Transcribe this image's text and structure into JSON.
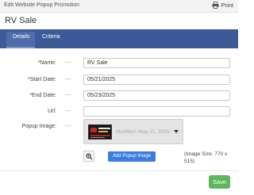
{
  "window": {
    "title": "Edit Website Popup Promotion",
    "print_label": "Print"
  },
  "heading": "RV Sale",
  "tabs": [
    {
      "label": "Details",
      "active": true
    },
    {
      "label": "Criteria",
      "active": false
    }
  ],
  "form": {
    "separator": "---",
    "name": {
      "label": "*Name:",
      "value": "RV Sale"
    },
    "start_date": {
      "label": "*Start Date:",
      "value": "05/21/2025"
    },
    "end_date": {
      "label": "*End Date:",
      "value": "05/23/2025"
    },
    "url": {
      "label": "Url:",
      "value": ""
    },
    "popup_image": {
      "label": "Popup Image:",
      "modified_text": "Modified: May 21, 2025"
    },
    "add_button": "Add Popup Image",
    "image_size_note": "(Image Size: 770 x 515)"
  },
  "footer": {
    "save_label": "Save"
  },
  "colors": {
    "tab_bar": "#3d5a98",
    "add_button": "#3a7de0",
    "save_button": "#5cb85c"
  },
  "icons": {
    "print": "printer-icon",
    "zoom": "magnifier-plus-icon",
    "dropdown": "caret-down-icon"
  }
}
